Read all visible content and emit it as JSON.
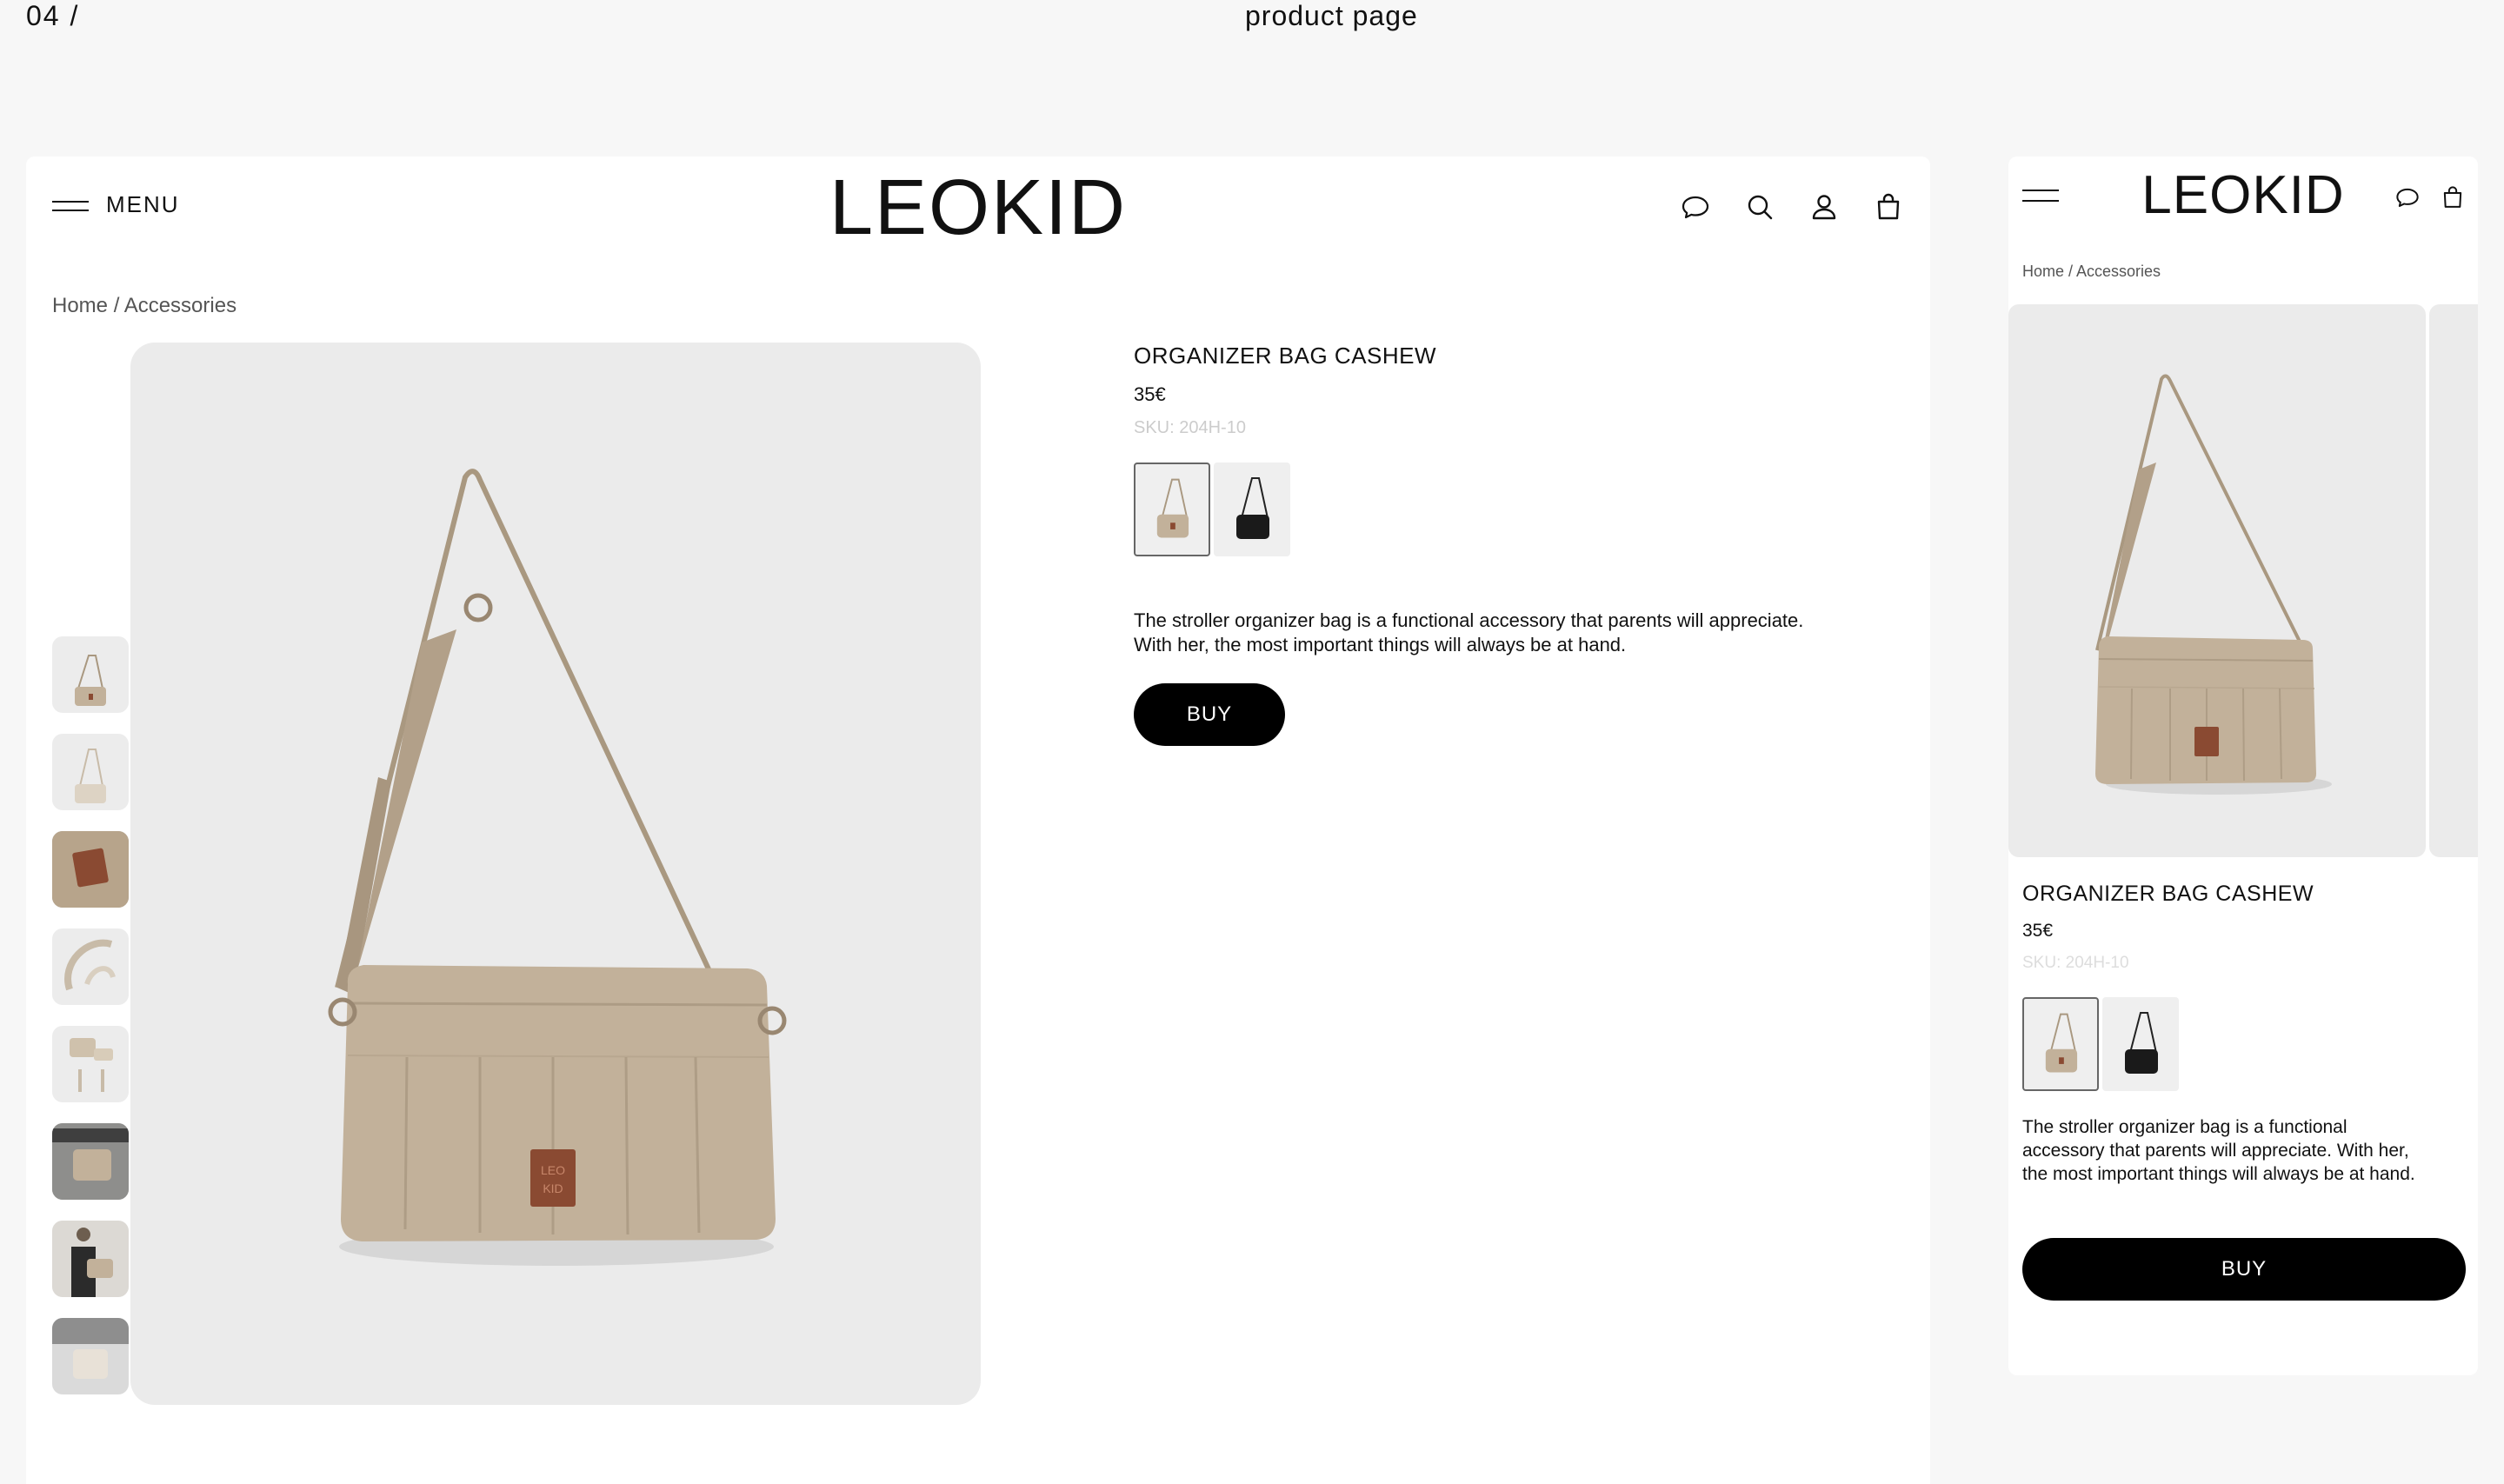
{
  "slide": {
    "number": "04 /",
    "title": "product page"
  },
  "header": {
    "menu_label": "MENU",
    "logo": "LEOKID",
    "icons": [
      "chat-icon",
      "search-icon",
      "user-icon",
      "bag-icon"
    ]
  },
  "breadcrumb": "Home / Accessories",
  "product": {
    "name": "ORGANIZER BAG CASHEW",
    "price": "35€",
    "sku": "SKU: 204H-10",
    "description_line1": "The stroller organizer bag is a functional accessory that parents will appreciate.",
    "description_line2": "With her, the most important things will always be at hand.",
    "description": "The stroller organizer bag is a functional accessory that parents will appreciate. With her, the most important things will always be at hand.",
    "buy_label": "BUY",
    "swatches": [
      {
        "name": "cashew",
        "color": "#c9b8a2",
        "selected": true
      },
      {
        "name": "black",
        "color": "#1a1a1a",
        "selected": false
      }
    ]
  },
  "colors": {
    "bag": "#c2b19a",
    "strap": "#a99880",
    "patch": "#8a4a32",
    "image_bg": "#ebebeb",
    "button": "#000000"
  },
  "mobile": {
    "logo": "LEOKID",
    "icons": [
      "chat-icon",
      "bag-icon"
    ]
  }
}
